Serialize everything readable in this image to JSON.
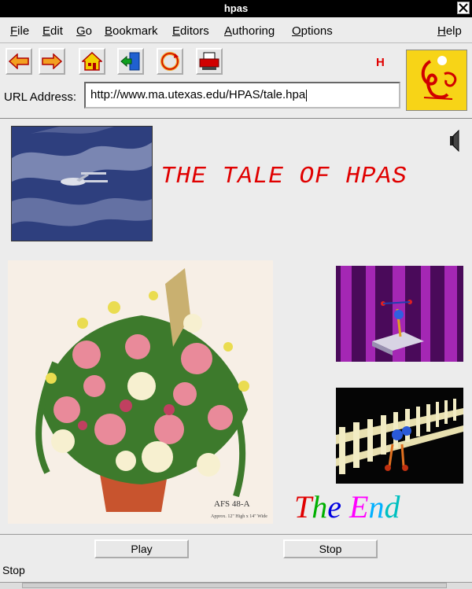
{
  "window": {
    "title": "hpas"
  },
  "menu": {
    "items": [
      {
        "label": "File",
        "key": "F",
        "rest": "ile"
      },
      {
        "label": "Edit",
        "key": "E",
        "rest": "dit"
      },
      {
        "label": "Go",
        "key": "G",
        "rest": "o"
      },
      {
        "label": "Bookmark",
        "key": "B",
        "rest": "ookmark"
      },
      {
        "label": "Editors",
        "key": "E",
        "rest": "ditors"
      },
      {
        "label": "Authoring",
        "key": "A",
        "rest": "uthoring"
      },
      {
        "label": "Options",
        "key": "O",
        "rest": "ptions"
      },
      {
        "label": "Help",
        "key": "H",
        "rest": "elp"
      }
    ]
  },
  "toolbar": {
    "buttons": [
      "back-icon",
      "forward-icon",
      "home-icon",
      "exit-icon",
      "reload-icon",
      "print-icon"
    ],
    "indicator": "H"
  },
  "url": {
    "label": "URL Address:",
    "value": "http://www.ma.utexas.edu/HPAS/tale.hpa"
  },
  "content": {
    "heading": "THE TALE OF HPAS",
    "end_text": [
      "T",
      "h",
      "e",
      " ",
      "E",
      "n",
      "d"
    ],
    "end_colors": [
      "#e00000",
      "#00b000",
      "#0000e0",
      "#ffffff",
      "#ff00ff",
      "#00b0ff",
      "#00c0c0"
    ],
    "photo_label": "AFS 48-A",
    "photo_note": "Approx. 12\" High x 14\" Wide"
  },
  "controls": {
    "play": "Play",
    "stop": "Stop"
  },
  "status": {
    "text": "Stop"
  },
  "colors": {
    "heading": "#e00000",
    "logo_bg": "#f7d417"
  }
}
